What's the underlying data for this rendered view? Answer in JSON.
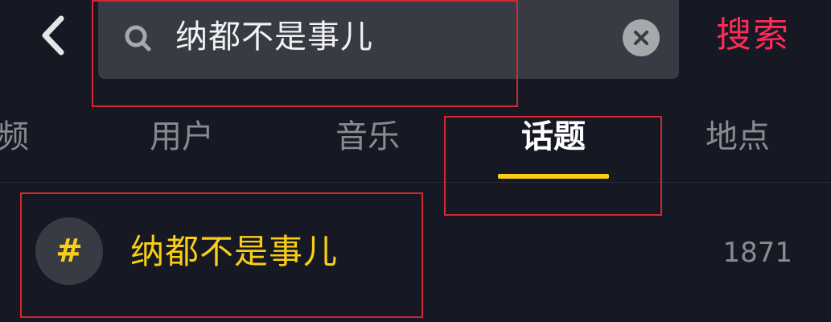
{
  "header": {
    "search_query": "纳都不是事儿",
    "search_button_label": "搜索"
  },
  "tabs": [
    {
      "label": "频",
      "active": false
    },
    {
      "label": "用户",
      "active": false
    },
    {
      "label": "音乐",
      "active": false
    },
    {
      "label": "话题",
      "active": true
    },
    {
      "label": "地点",
      "active": false
    }
  ],
  "results": [
    {
      "icon_glyph": "#",
      "title": "纳都不是事儿",
      "count": "1871"
    }
  ],
  "colors": {
    "accent_red": "#fe2c55",
    "accent_yellow": "#face15",
    "annotation_red": "#d7262e",
    "background": "#161823"
  },
  "icons": [
    "back-icon",
    "search-icon",
    "clear-icon",
    "hashtag-icon"
  ]
}
